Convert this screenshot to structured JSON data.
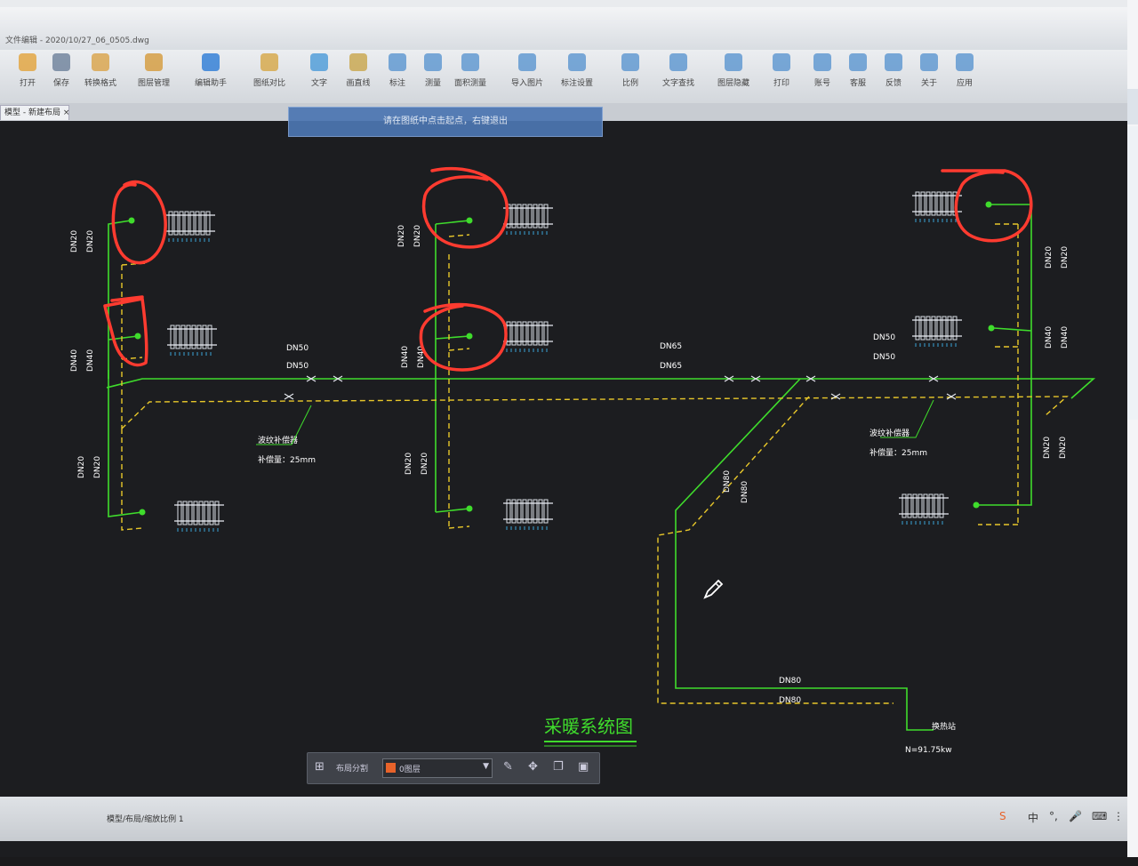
{
  "window": {
    "title": "文件编辑 - 2020/10/27_06_0505.dwg",
    "tab_label": "模型 - 新建布局 ×"
  },
  "ribbon": [
    {
      "label": "打开",
      "icon": "folder-open-icon",
      "color": "#e2a23a"
    },
    {
      "label": "保存",
      "icon": "save-icon",
      "color": "#6c7f9a"
    },
    {
      "label": "转换格式",
      "icon": "convert-icon",
      "color": "#d9a347"
    },
    {
      "label": "图层管理",
      "icon": "layers-icon",
      "color": "#d49a3a"
    },
    {
      "label": "编辑助手",
      "icon": "edit-helper-icon",
      "color": "#2b7bd6"
    },
    {
      "label": "图纸对比",
      "icon": "compare-icon",
      "color": "#d6a645"
    },
    {
      "label": "文字",
      "icon": "text-icon",
      "color": "#4a9ad8"
    },
    {
      "label": "画直线",
      "icon": "line-icon",
      "color": "#c8a54a"
    },
    {
      "label": "标注",
      "icon": "dimension-icon",
      "color": "#5a95d0"
    },
    {
      "label": "测量",
      "icon": "measure-icon",
      "color": "#5a95d0"
    },
    {
      "label": "面积测量",
      "icon": "area-icon",
      "color": "#5a95d0"
    },
    {
      "label": "导入图片",
      "icon": "import-image-icon",
      "color": "#5a95d0"
    },
    {
      "label": "标注设置",
      "icon": "annotation-settings-icon",
      "color": "#5a95d0"
    },
    {
      "label": "比例",
      "icon": "scale-icon",
      "color": "#5a95d0"
    },
    {
      "label": "文字查找",
      "icon": "text-search-icon",
      "color": "#5a95d0"
    },
    {
      "label": "图层隐藏",
      "icon": "layer-hide-icon",
      "color": "#5a95d0"
    },
    {
      "label": "打印",
      "icon": "print-icon",
      "color": "#5a95d0"
    },
    {
      "label": "账号",
      "icon": "account-icon",
      "color": "#5a95d0"
    },
    {
      "label": "客服",
      "icon": "support-icon",
      "color": "#5a95d0"
    },
    {
      "label": "反馈",
      "icon": "feedback-icon",
      "color": "#5a95d0"
    },
    {
      "label": "关于",
      "icon": "about-icon",
      "color": "#5a95d0"
    },
    {
      "label": "应用",
      "icon": "apps-icon",
      "color": "#5a95d0"
    }
  ],
  "prompt_banner": "请在图纸中点击起点，右键退出",
  "drawing": {
    "pipe_labels": {
      "dn20": "DN20",
      "dn40": "DN40",
      "dn50": "DN50",
      "dn65": "DN65",
      "dn80": "DN80"
    },
    "expansion_joint_label": "波纹补偿器",
    "compensation_label": "补偿量：25mm",
    "heat_source_label": "换热站",
    "load_label": "N=91.75kw",
    "diagram_title": "采暖系统图"
  },
  "floating_toolbar": {
    "label": "布局分割",
    "select_value": "0图层",
    "icons": [
      "grid-icon",
      "edit-icon",
      "move-icon",
      "copy-icon",
      "paste-icon"
    ]
  },
  "statusbar": {
    "text": "模型/布局/缩放比例 1",
    "tray_icons": [
      {
        "icon": "sogou-icon",
        "glyph": "S"
      },
      {
        "icon": "ime-chinese-icon",
        "glyph": "中"
      },
      {
        "icon": "punctuation-icon",
        "glyph": "°,"
      },
      {
        "icon": "microphone-icon",
        "glyph": "🎤"
      },
      {
        "icon": "keyboard-icon",
        "glyph": "⌨"
      },
      {
        "icon": "menu-icon",
        "glyph": "⋮"
      }
    ]
  },
  "annotation_color": "#ff3b30",
  "supply_pipe_color": "#3fdc2c",
  "return_pipe_color": "#e8c72a"
}
